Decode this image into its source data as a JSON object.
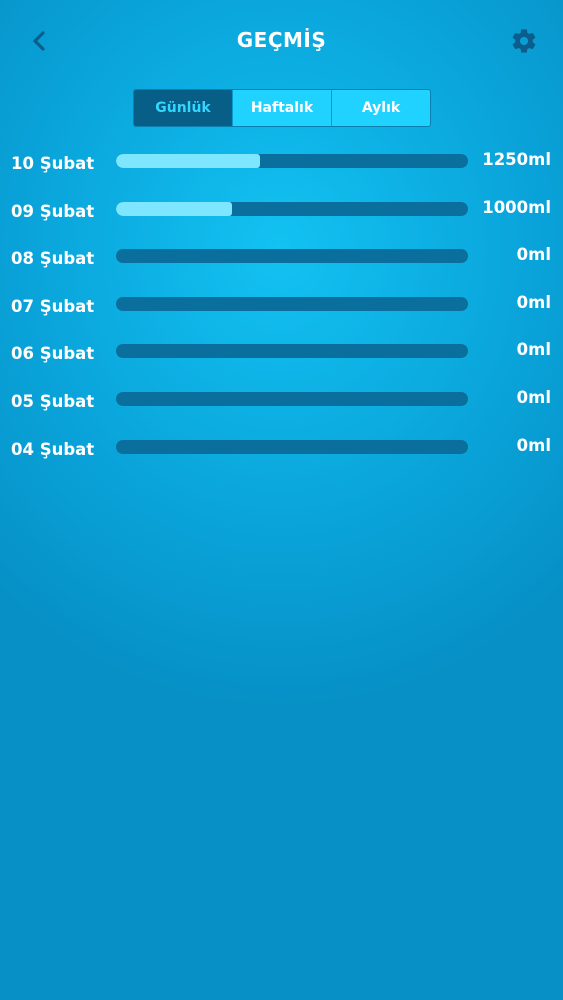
{
  "header": {
    "title": "GEÇMİŞ",
    "back_icon": "chevron-left-icon",
    "settings_icon": "gear-icon"
  },
  "tabs": [
    {
      "label": "Günlük",
      "active": true
    },
    {
      "label": "Haftalık",
      "active": false
    },
    {
      "label": "Aylık",
      "active": false
    }
  ],
  "history": [
    {
      "date": "10 Şubat",
      "amount": "1250ml",
      "progress": 0.41
    },
    {
      "date": "09 Şubat",
      "amount": "1000ml",
      "progress": 0.33
    },
    {
      "date": "08 Şubat",
      "amount": "0ml",
      "progress": 0
    },
    {
      "date": "07 Şubat",
      "amount": "0ml",
      "progress": 0
    },
    {
      "date": "06 Şubat",
      "amount": "0ml",
      "progress": 0
    },
    {
      "date": "05 Şubat",
      "amount": "0ml",
      "progress": 0
    },
    {
      "date": "04 Şubat",
      "amount": "0ml",
      "progress": 0
    }
  ],
  "colors": {
    "accent": "#1fd2ff",
    "active_tab": "#075e86",
    "bar_track": "#0a6f9c",
    "bar_fill": "#7ee6ff",
    "icon": "#0b5e8c"
  }
}
